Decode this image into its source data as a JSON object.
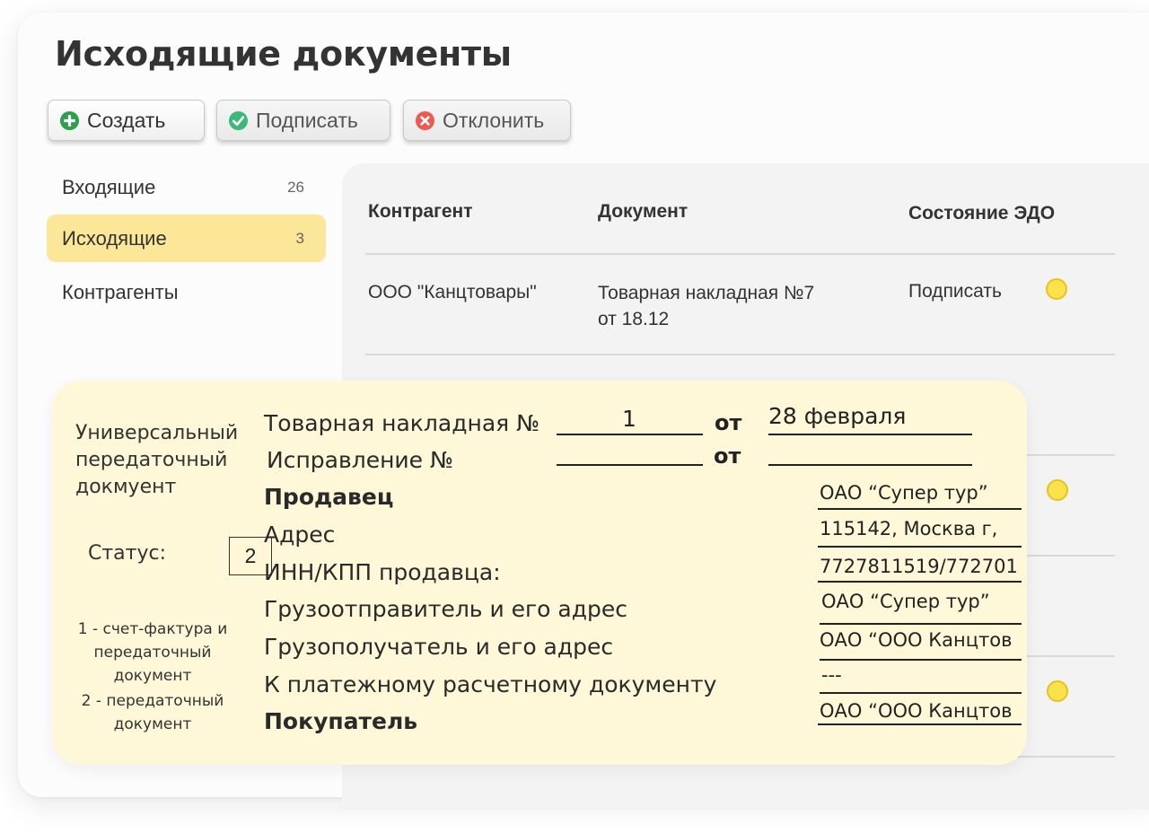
{
  "page": {
    "title": "Исходящие документы"
  },
  "toolbar": {
    "create_label": "Создать",
    "sign_label": "Подписать",
    "reject_label": "Отклонить"
  },
  "sidebar": {
    "items": [
      {
        "label": "Входящие",
        "count": "26"
      },
      {
        "label": "Исходящие",
        "count": "3"
      },
      {
        "label": "Контрагенты",
        "count": ""
      }
    ]
  },
  "table": {
    "headers": {
      "counterparty": "Контрагент",
      "document": "Документ",
      "status": "Состояние ЭДО"
    },
    "rows": [
      {
        "counterparty": "ООО \"Канцтовары\"",
        "document_line1": "Товарная накладная №7",
        "document_line2": "от 18.12",
        "status": "Подписать"
      }
    ]
  },
  "upd": {
    "doc_type": "Универсальный передаточный докмуент",
    "status_label": "Статус:",
    "status_value": "2",
    "legend_1": "1 - счет-фактура и передаточный документ",
    "legend_2": "2 -  передаточный документ",
    "invoice_label": "Товарная накладная №",
    "invoice_number": "1",
    "from_label": "от",
    "invoice_date": "28 февраля",
    "correction_label": "Исправление №",
    "correction_from_label": "от",
    "seller_label": "Продавец",
    "seller_value": "ОАО “Супер тур”",
    "address_label": "Адрес",
    "address_value": "115142, Москва г,",
    "inn_label": "ИНН/КПП продавца:",
    "inn_value": "7727811519/772701",
    "shipper_label": "Грузоотправитель и его адрес",
    "shipper_value": "ОАО “Супер тур”",
    "consignee_label": "Грузополучатель и его адрес",
    "consignee_value": "ОАО “ООО Канцтов",
    "payment_label": "К платежному расчетному документу",
    "payment_value": "---",
    "buyer_label": "Покупатель",
    "buyer_value": "ОАО “ООО Канцтов"
  },
  "colors": {
    "active_item": "#fce697",
    "card_bg": "#fef7d8",
    "status_dot": "#fbe14c",
    "create_icon": "#2e9e4f",
    "sign_icon": "#3cb878",
    "reject_icon": "#ee5a52"
  }
}
